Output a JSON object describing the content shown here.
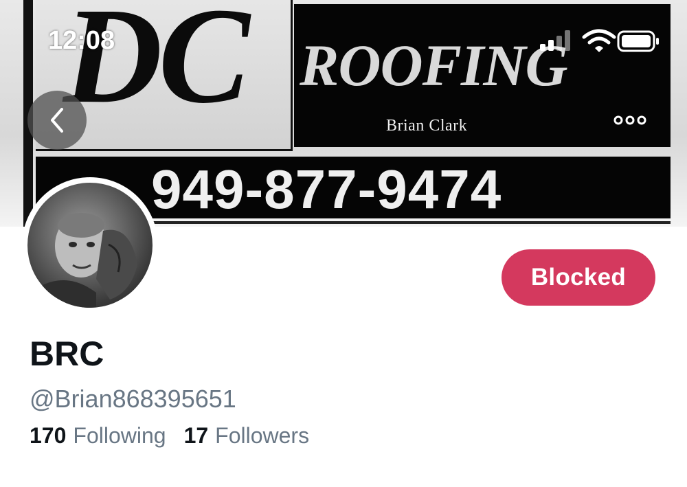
{
  "status_bar": {
    "time": "12:08",
    "icons": [
      "cellular-signal-icon",
      "wifi-icon",
      "battery-icon"
    ]
  },
  "banner": {
    "logo_letters": "DC",
    "business_name": "ROOFING",
    "owner_name": "Brian Clark",
    "phone": "949-877-9474"
  },
  "nav": {
    "back_icon": "chevron-left-icon",
    "more_icon": "more-horizontal-icon"
  },
  "profile": {
    "display_name": "BRC",
    "handle": "@Brian868395651",
    "following_count": "170",
    "following_label": "Following",
    "followers_count": "17",
    "followers_label": "Followers"
  },
  "actions": {
    "blocked_label": "Blocked"
  },
  "colors": {
    "blocked_button": "#d4395e",
    "primary_text": "#0f1419",
    "secondary_text": "#687684"
  }
}
